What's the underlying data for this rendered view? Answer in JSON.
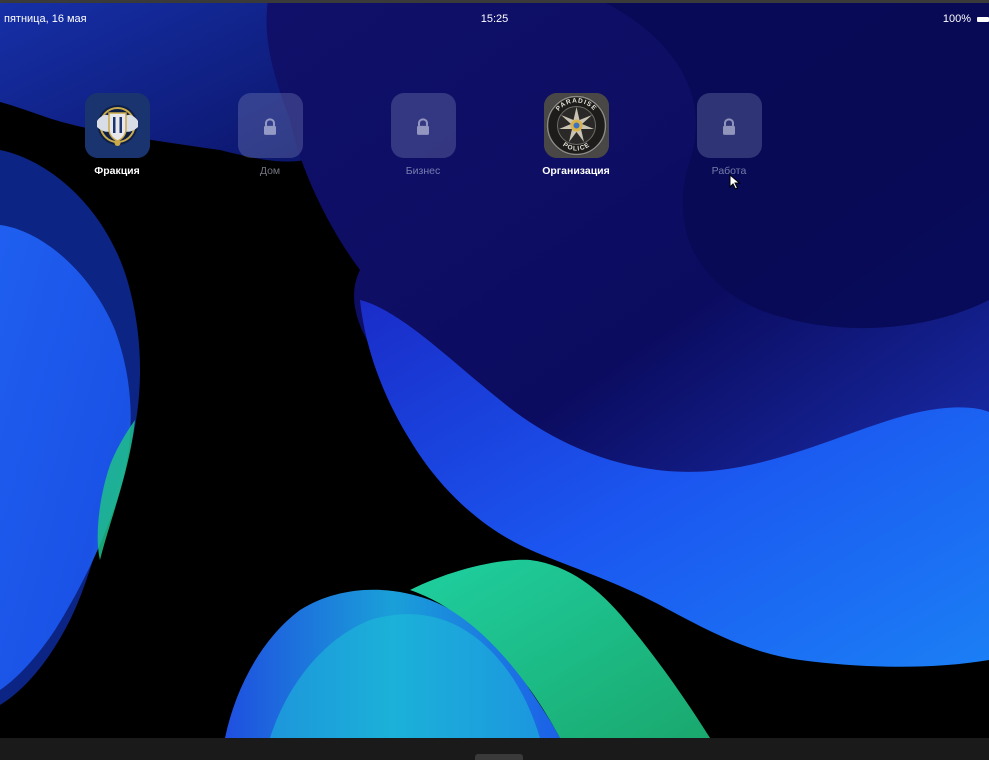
{
  "status_bar": {
    "date": "пятница, 16 мая",
    "time": "15:25",
    "battery": "100%"
  },
  "apps": [
    {
      "label": "Фракция",
      "locked": false,
      "icon": "faction-emblem-icon"
    },
    {
      "label": "Дом",
      "locked": true,
      "icon": "lock-icon"
    },
    {
      "label": "Бизнес",
      "locked": true,
      "icon": "lock-icon"
    },
    {
      "label": "Организация",
      "locked": false,
      "icon": "police-badge-icon"
    },
    {
      "label": "Работа",
      "locked": true,
      "icon": "lock-icon"
    }
  ],
  "badge": {
    "top_text": "PARADISE",
    "bottom_text": "POLICE"
  },
  "colors": {
    "wallpaper_dark": "#000000",
    "wallpaper_navy": "#0a1070",
    "wallpaper_blue": "#1a44e0",
    "wallpaper_green": "#22d98a"
  }
}
